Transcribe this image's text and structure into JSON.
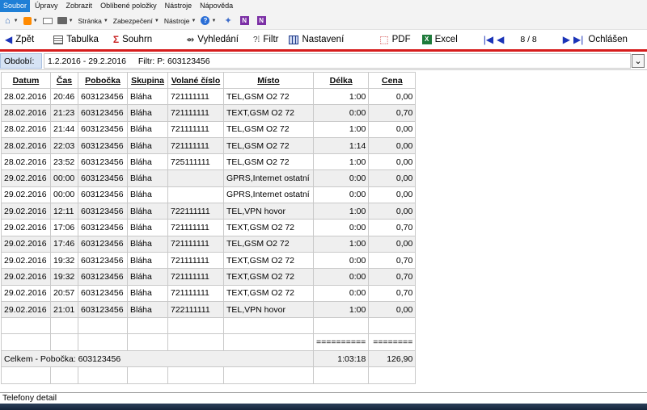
{
  "menu": [
    "Soubor",
    "Úpravy",
    "Zobrazit",
    "Oblíbené položky",
    "Nástroje",
    "Nápověda"
  ],
  "browser_bar": {
    "page_label": "Stránka",
    "security_label": "Zabezpečení",
    "tools_label": "Nástroje",
    "icons": [
      "home-icon",
      "rss-icon",
      "mail-icon",
      "print-icon",
      "help-icon",
      "accelerator-icon",
      "onenote-icon",
      "onenote-icon"
    ]
  },
  "toolbar": {
    "back": "Zpět",
    "table": "Tabulka",
    "summary": "Souhrn",
    "search": "Vyhledání",
    "filter": "Filtr",
    "settings": "Nastavení",
    "pdf": "PDF",
    "excel": "Excel",
    "page_indicator": "8 / 8",
    "logout": "Ochlášen"
  },
  "filter": {
    "period_label": "Období:",
    "period_value": "1.2.2016 - 29.2.2016",
    "filter_text": "Filtr:  P: 603123456"
  },
  "table": {
    "columns": [
      "Datum",
      "Čas",
      "Pobočka",
      "Skupina",
      "Volané číslo",
      "Místo",
      "Délka",
      "Cena"
    ],
    "rows": [
      [
        "28.02.2016",
        "20:46",
        "603123456",
        "Bláha",
        "721111111",
        "TEL,GSM O2 72",
        "1:00",
        "0,00"
      ],
      [
        "28.02.2016",
        "21:23",
        "603123456",
        "Bláha",
        "721111111",
        "TEXT,GSM O2 72",
        "0:00",
        "0,70"
      ],
      [
        "28.02.2016",
        "21:44",
        "603123456",
        "Bláha",
        "721111111",
        "TEL,GSM O2 72",
        "1:00",
        "0,00"
      ],
      [
        "28.02.2016",
        "22:03",
        "603123456",
        "Bláha",
        "721111111",
        "TEL,GSM O2 72",
        "1:14",
        "0,00"
      ],
      [
        "28.02.2016",
        "23:52",
        "603123456",
        "Bláha",
        "725111111",
        "TEL,GSM O2 72",
        "1:00",
        "0,00"
      ],
      [
        "29.02.2016",
        "00:00",
        "603123456",
        "Bláha",
        "",
        "GPRS,Internet ostatní",
        "0:00",
        "0,00"
      ],
      [
        "29.02.2016",
        "00:00",
        "603123456",
        "Bláha",
        "",
        "GPRS,Internet ostatní",
        "0:00",
        "0,00"
      ],
      [
        "29.02.2016",
        "12:11",
        "603123456",
        "Bláha",
        "722111111",
        "TEL,VPN hovor",
        "1:00",
        "0,00"
      ],
      [
        "29.02.2016",
        "17:06",
        "603123456",
        "Bláha",
        "721111111",
        "TEXT,GSM O2 72",
        "0:00",
        "0,70"
      ],
      [
        "29.02.2016",
        "17:46",
        "603123456",
        "Bláha",
        "721111111",
        "TEL,GSM O2 72",
        "1:00",
        "0,00"
      ],
      [
        "29.02.2016",
        "19:32",
        "603123456",
        "Bláha",
        "721111111",
        "TEXT,GSM O2 72",
        "0:00",
        "0,70"
      ],
      [
        "29.02.2016",
        "19:32",
        "603123456",
        "Bláha",
        "721111111",
        "TEXT,GSM O2 72",
        "0:00",
        "0,70"
      ],
      [
        "29.02.2016",
        "20:57",
        "603123456",
        "Bláha",
        "721111111",
        "TEXT,GSM O2 72",
        "0:00",
        "0,70"
      ],
      [
        "29.02.2016",
        "21:01",
        "603123456",
        "Bláha",
        "722111111",
        "TEL,VPN hovor",
        "1:00",
        "0,00"
      ]
    ],
    "separator": [
      "==========",
      "========"
    ],
    "total": {
      "label": "Celkem - Pobočka: 603123456",
      "duration": "1:03:18",
      "price": "126,90"
    }
  },
  "status": "Telefony detail"
}
